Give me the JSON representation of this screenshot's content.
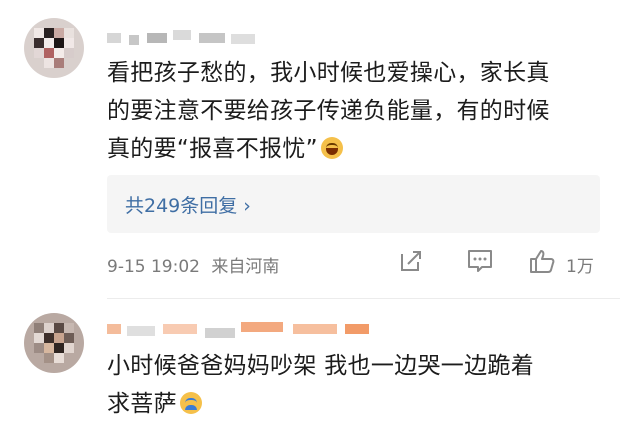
{
  "comment1": {
    "avatar": "avatar-image",
    "username": "",
    "text_line1": "看把孩子愁的，我小时候也爱操心，家长真",
    "text_line2": "的要注意不要给孩子传递负能量，有的时候",
    "text_line3": "真的要“报喜不报忧”",
    "emoji": "grinning-sweat-emoji",
    "replies_label": "共249条回复 ›",
    "timestamp": "9-15 19:02",
    "location": "来自河南",
    "like_count": "1万",
    "icons": [
      "share-icon",
      "comment-icon",
      "like-icon"
    ]
  },
  "comment2": {
    "avatar": "avatar-image",
    "username": "",
    "text_line1": "小时候爸爸妈妈吵架 我也一边哭一边跪着",
    "text_line2": "求菩萨",
    "emoji": "crying-emoji"
  },
  "colors": {
    "link": "#3f6ea4",
    "meta_text": "#7a7a7a",
    "reply_box_bg": "#f5f5f5"
  }
}
